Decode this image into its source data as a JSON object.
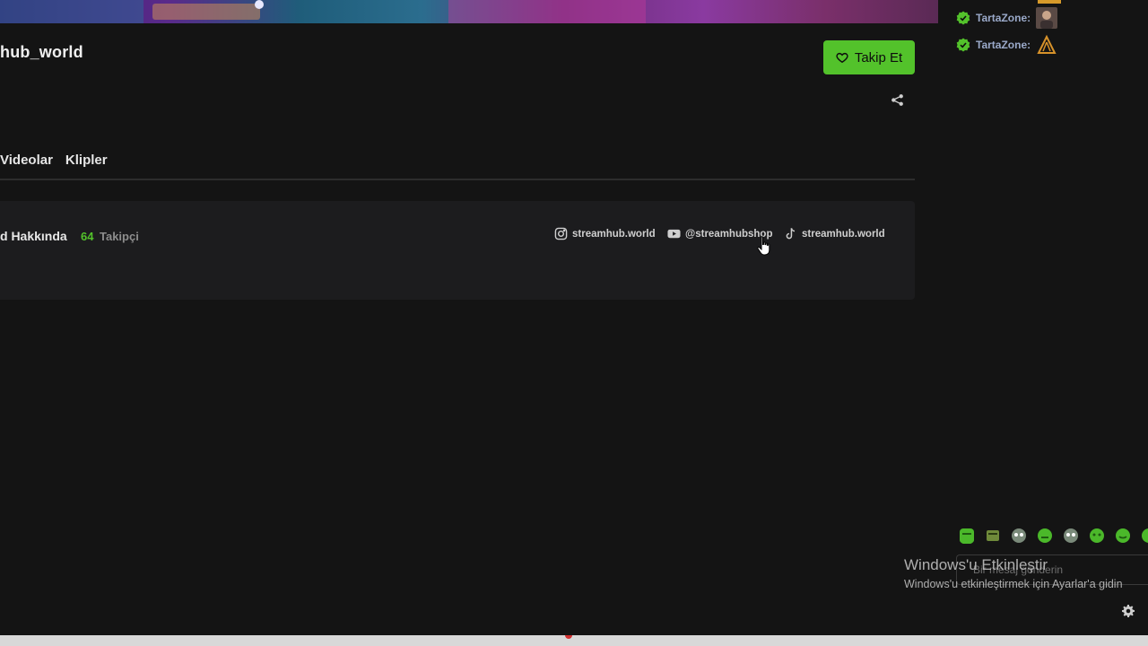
{
  "channel": {
    "name": "hub_world"
  },
  "header": {
    "follow_label": "Takip Et"
  },
  "tabs": [
    {
      "label": "Videolar"
    },
    {
      "label": "Klipler"
    }
  ],
  "about": {
    "title": "d Hakkında",
    "follower_count": "64",
    "follower_label": "Takipçi",
    "socials": [
      {
        "icon": "instagram-icon",
        "label": "streamhub.world"
      },
      {
        "icon": "youtube-icon",
        "label": "@streamhubshop"
      },
      {
        "icon": "tiktok-icon",
        "label": "streamhub.world"
      }
    ]
  },
  "chat": {
    "messages": [
      {
        "user": "TartaZone:",
        "badge": "verified-badge-icon",
        "emote": "portrait-emote"
      },
      {
        "user": "TartaZone:",
        "badge": "verified-badge-icon",
        "emote": "logo-emote"
      }
    ],
    "input_placeholder": "Bir mesaj gönderin",
    "emote_bar": [
      "green-emote-1",
      "green-emote-2",
      "green-emote-3",
      "green-emote-4",
      "green-emote-5",
      "green-emote-6",
      "green-emote-7",
      "green-emote-8"
    ]
  },
  "watermark": {
    "title": "Windows'u Etkinleştir",
    "subtitle": "Windows'u etkinleştirmek için Ayarlar'a gidin"
  },
  "colors": {
    "accent": "#53c22b",
    "background": "#141414",
    "panel": "#1c1c1e"
  }
}
